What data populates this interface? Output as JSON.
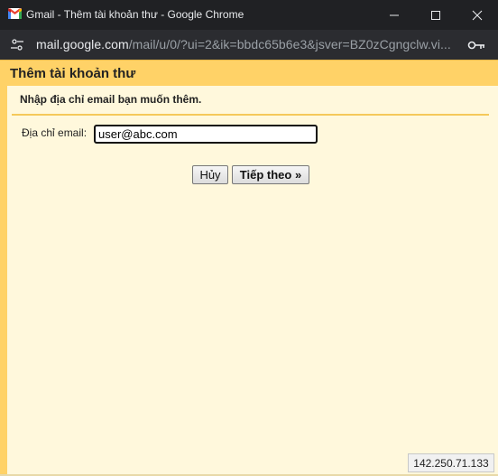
{
  "window": {
    "title": "Gmail - Thêm tài khoản thư - Google Chrome",
    "controls": [
      "minimize-icon",
      "maximize-icon",
      "close-icon"
    ]
  },
  "address_bar": {
    "url_host": "mail.google.com",
    "url_path": "/mail/u/0/?ui=2&ik=bbdc65b6e3&jsver=BZ0zCgngclw.vi...",
    "left_icon": "tune-icon",
    "right_icon": "key-icon"
  },
  "dialog": {
    "title": "Thêm tài khoản thư",
    "instruction": "Nhập địa chỉ email bạn muốn thêm.",
    "email_label": "Địa chỉ email:",
    "email_value": "user@abc.com",
    "cancel_label": "Hủy",
    "next_label": "Tiếp theo »"
  },
  "status": {
    "ip": "142.250.71.133"
  },
  "colors": {
    "titlebar": "#202124",
    "header": "#ffd267",
    "background": "#fff8dc"
  }
}
